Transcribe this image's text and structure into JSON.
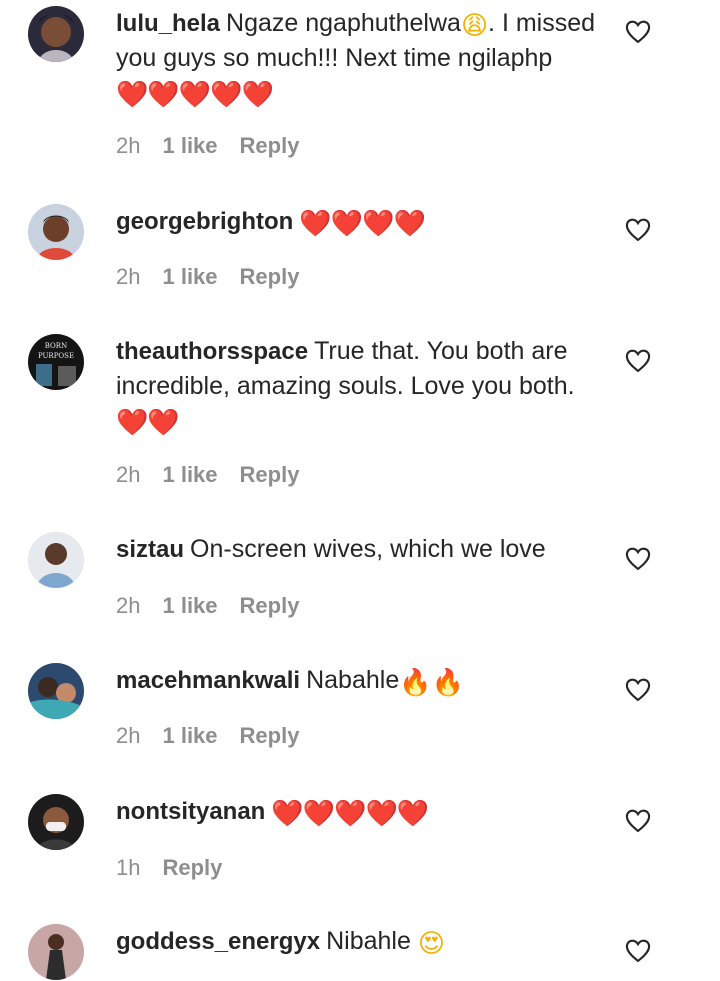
{
  "comments": [
    {
      "username": "lulu_hela",
      "text": "Ngaze ngaphuthelwa",
      "emoji_a": "😩",
      "text_b": ". I missed you guys so much!!! Next time ngilaphp",
      "emoji_b": "❤️❤️❤️❤️❤️",
      "time": "2h",
      "likes": "1 like",
      "reply": "Reply"
    },
    {
      "username": "georgebrighton",
      "text": "",
      "emoji_b": "❤️❤️❤️❤️",
      "time": "2h",
      "likes": "1 like",
      "reply": "Reply"
    },
    {
      "username": "theauthorsspace",
      "text": "True that. You both are incredible, amazing souls. Love you both. ",
      "emoji_b": "❤️❤️",
      "time": "2h",
      "likes": "1 like",
      "reply": "Reply"
    },
    {
      "username": "siztau",
      "text": "On-screen wives, which we love",
      "time": "2h",
      "likes": "1 like",
      "reply": "Reply"
    },
    {
      "username": "macehmankwali",
      "text": "Nabahle",
      "emoji_b": "🔥🔥",
      "time": "2h",
      "likes": "1 like",
      "reply": "Reply"
    },
    {
      "username": "nontsityanan",
      "text": "",
      "emoji_b": "❤️❤️❤️❤️❤️",
      "time": "1h",
      "reply": "Reply"
    },
    {
      "username": "goddess_energyx",
      "text": "Nibahle ",
      "emoji_b": "😍",
      "time": "",
      "reply": ""
    }
  ],
  "avatar_text": {
    "theauthorsspace_line1": "BORN",
    "theauthorsspace_line2": "PURPOSE"
  },
  "icons": {
    "like": "heart-outline-icon"
  },
  "colors": {
    "text": "#262626",
    "meta": "#8e8e8e",
    "heart_emoji": "#e02424"
  }
}
